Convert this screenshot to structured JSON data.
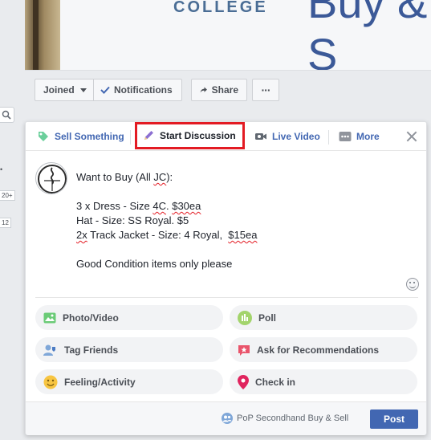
{
  "cover": {
    "college_text": "COLLEGE",
    "title_fragment": "Buy & S"
  },
  "left_fragments": {
    "item_a": "•",
    "badge_1": "20+",
    "badge_2": "12"
  },
  "action_bar": {
    "joined_label": "Joined",
    "notifications_label": "Notifications",
    "share_label": "Share",
    "more_label": "···"
  },
  "composer": {
    "tabs": [
      {
        "label": "Sell Something",
        "icon": "price-tag-icon"
      },
      {
        "label": "Start Discussion",
        "icon": "pencil-icon",
        "highlighted": true
      },
      {
        "label": "Live Video",
        "icon": "video-camera-icon"
      },
      {
        "label": "More",
        "icon": "more-dots-icon"
      }
    ],
    "post_lines": [
      "Want to Buy (All JC):",
      "",
      "3 x Dress - Size 4C. $30ea",
      "Hat - Size: SS Royal. $5",
      "2x Track Jacket - Size: 4 Royal,  $15ea",
      "",
      "Good Condition items only please"
    ],
    "options": [
      {
        "label": "Photo/Video",
        "icon": "photo-icon"
      },
      {
        "label": "Poll",
        "icon": "poll-icon"
      },
      {
        "label": "Tag Friends",
        "icon": "tag-friends-icon"
      },
      {
        "label": "Ask for Recommendations",
        "icon": "recommendations-icon"
      },
      {
        "label": "Feeling/Activity",
        "icon": "feeling-icon"
      },
      {
        "label": "Check in",
        "icon": "location-pin-icon"
      }
    ],
    "audience_label": "PoP Secondhand Buy & Sell",
    "post_button": "Post"
  },
  "colors": {
    "accent": "#4267b2",
    "highlight_box": "#e31b23",
    "background": "#e9ebee"
  }
}
